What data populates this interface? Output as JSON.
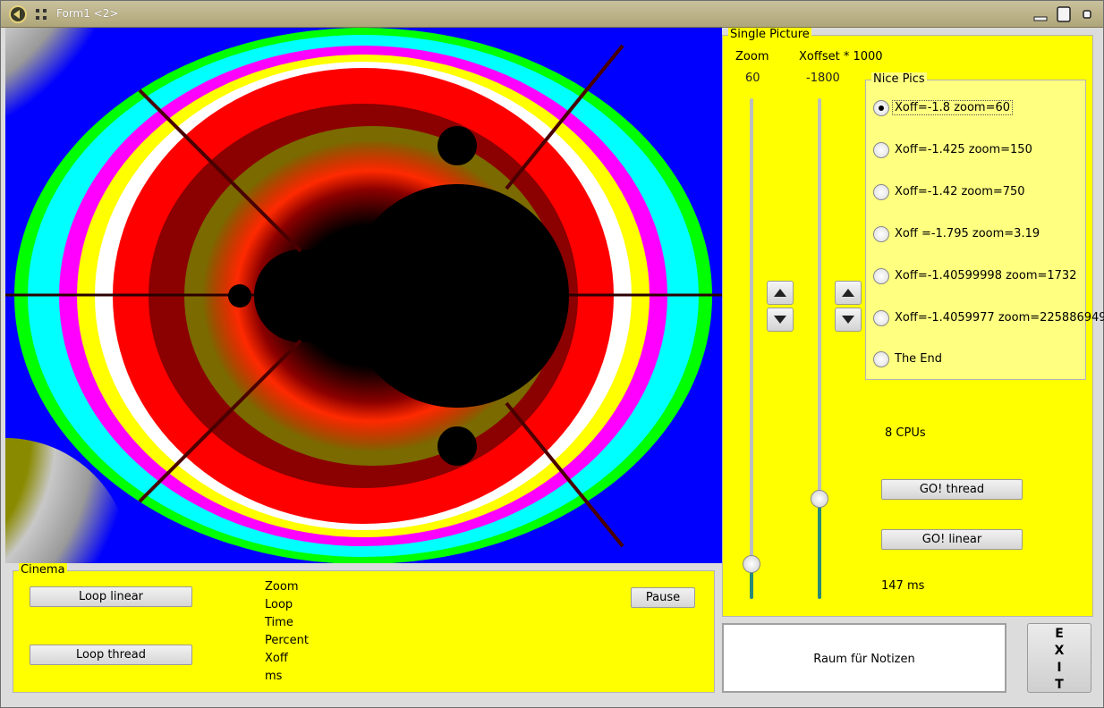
{
  "window": {
    "title": "Form1 <2>"
  },
  "cinema": {
    "legend": "Cinema",
    "loop_linear": "Loop linear",
    "loop_thread": "Loop thread",
    "pause": "Pause",
    "info_labels": [
      "Zoom",
      "Loop",
      "Time",
      "Percent",
      "Xoff",
      "ms"
    ]
  },
  "single": {
    "legend": "Single Picture",
    "zoom_label": "Zoom",
    "zoom_value": "60",
    "xoffset_label": "Xoffset * 1000",
    "xoffset_value": "-1800",
    "zoom_slider_level": 0.07,
    "xoffset_slider_level": 0.2,
    "cpus": "8 CPUs",
    "go_thread": "GO! thread",
    "go_linear": "GO! linear",
    "time": "147 ms"
  },
  "nice_pics": {
    "legend": "Nice Pics",
    "selected": 0,
    "options": [
      "Xoff=-1.8 zoom=60",
      "Xoff=-1.425 zoom=150",
      "Xoff=-1.42 zoom=750",
      "Xoff =-1.795 zoom=3.19",
      "Xoff=-1.40599998 zoom=1732",
      "Xoff=-1.4059977 zoom=225886949",
      "The End"
    ]
  },
  "notes": {
    "text": "Raum für Notizen"
  },
  "exit": {
    "letters": [
      "E",
      "X",
      "I",
      "T"
    ]
  },
  "colors": {
    "panel": "#ffff00",
    "title_bar": "#b8ae84",
    "slider_fill": "#2a8a7a"
  }
}
